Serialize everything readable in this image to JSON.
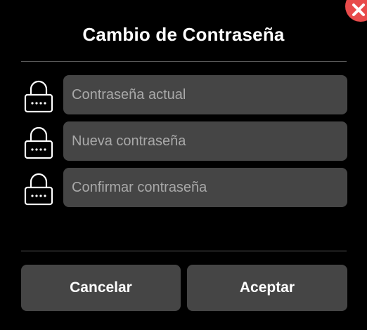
{
  "dialog": {
    "title": "Cambio de Contraseña",
    "close_icon": "close-x-icon",
    "close_color": "#e84b4b"
  },
  "fields": [
    {
      "icon": "lock-icon",
      "placeholder": "Contraseña actual",
      "value": ""
    },
    {
      "icon": "lock-icon",
      "placeholder": "Nueva contraseña",
      "value": ""
    },
    {
      "icon": "lock-icon",
      "placeholder": "Confirmar contraseña",
      "value": ""
    }
  ],
  "buttons": {
    "cancel_label": "Cancelar",
    "accept_label": "Aceptar"
  },
  "colors": {
    "background": "#000000",
    "field_background": "#454545",
    "button_background": "#454545",
    "placeholder": "#a9a9a9",
    "divider": "#5a5a5a"
  }
}
